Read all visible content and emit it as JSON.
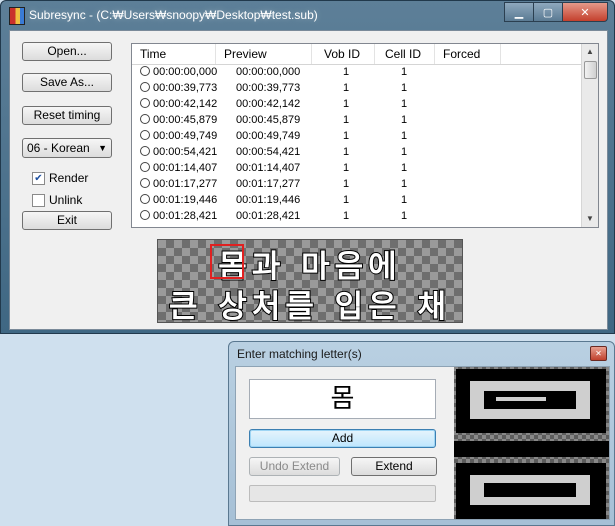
{
  "main_window": {
    "title": "Subresync - (C:₩Users₩snoopy₩Desktop₩test.sub)",
    "buttons": {
      "open": "Open...",
      "save_as": "Save As...",
      "reset_timing": "Reset timing",
      "exit": "Exit"
    },
    "language_select": "06 - Korean",
    "render_label": "Render",
    "render_checked": true,
    "unlink_label": "Unlink",
    "unlink_checked": false,
    "list": {
      "columns": [
        "Time",
        "Preview",
        "Vob ID",
        "Cell ID",
        "Forced"
      ],
      "rows": [
        {
          "time": "00:00:00,000",
          "preview": "00:00:00,000",
          "vob_id": "1",
          "cell_id": "1",
          "forced": ""
        },
        {
          "time": "00:00:39,773",
          "preview": "00:00:39,773",
          "vob_id": "1",
          "cell_id": "1",
          "forced": ""
        },
        {
          "time": "00:00:42,142",
          "preview": "00:00:42,142",
          "vob_id": "1",
          "cell_id": "1",
          "forced": ""
        },
        {
          "time": "00:00:45,879",
          "preview": "00:00:45,879",
          "vob_id": "1",
          "cell_id": "1",
          "forced": ""
        },
        {
          "time": "00:00:49,749",
          "preview": "00:00:49,749",
          "vob_id": "1",
          "cell_id": "1",
          "forced": ""
        },
        {
          "time": "00:00:54,421",
          "preview": "00:00:54,421",
          "vob_id": "1",
          "cell_id": "1",
          "forced": ""
        },
        {
          "time": "00:01:14,407",
          "preview": "00:01:14,407",
          "vob_id": "1",
          "cell_id": "1",
          "forced": ""
        },
        {
          "time": "00:01:17,277",
          "preview": "00:01:17,277",
          "vob_id": "1",
          "cell_id": "1",
          "forced": ""
        },
        {
          "time": "00:01:19,446",
          "preview": "00:01:19,446",
          "vob_id": "1",
          "cell_id": "1",
          "forced": ""
        },
        {
          "time": "00:01:28,421",
          "preview": "00:01:28,421",
          "vob_id": "1",
          "cell_id": "1",
          "forced": ""
        }
      ]
    },
    "subtitle_preview": {
      "line1": "몸과 마음에",
      "line2": "큰 상처를 입은 채",
      "highlighted_char": "몸"
    }
  },
  "dialog": {
    "title": "Enter matching letter(s)",
    "letter_value": "몸",
    "add_label": "Add",
    "undo_extend_label": "Undo Extend",
    "extend_label": "Extend",
    "close_icon": "close-icon"
  },
  "colors": {
    "highlight": "#e02020",
    "add_button_border": "#3c7fb1"
  }
}
